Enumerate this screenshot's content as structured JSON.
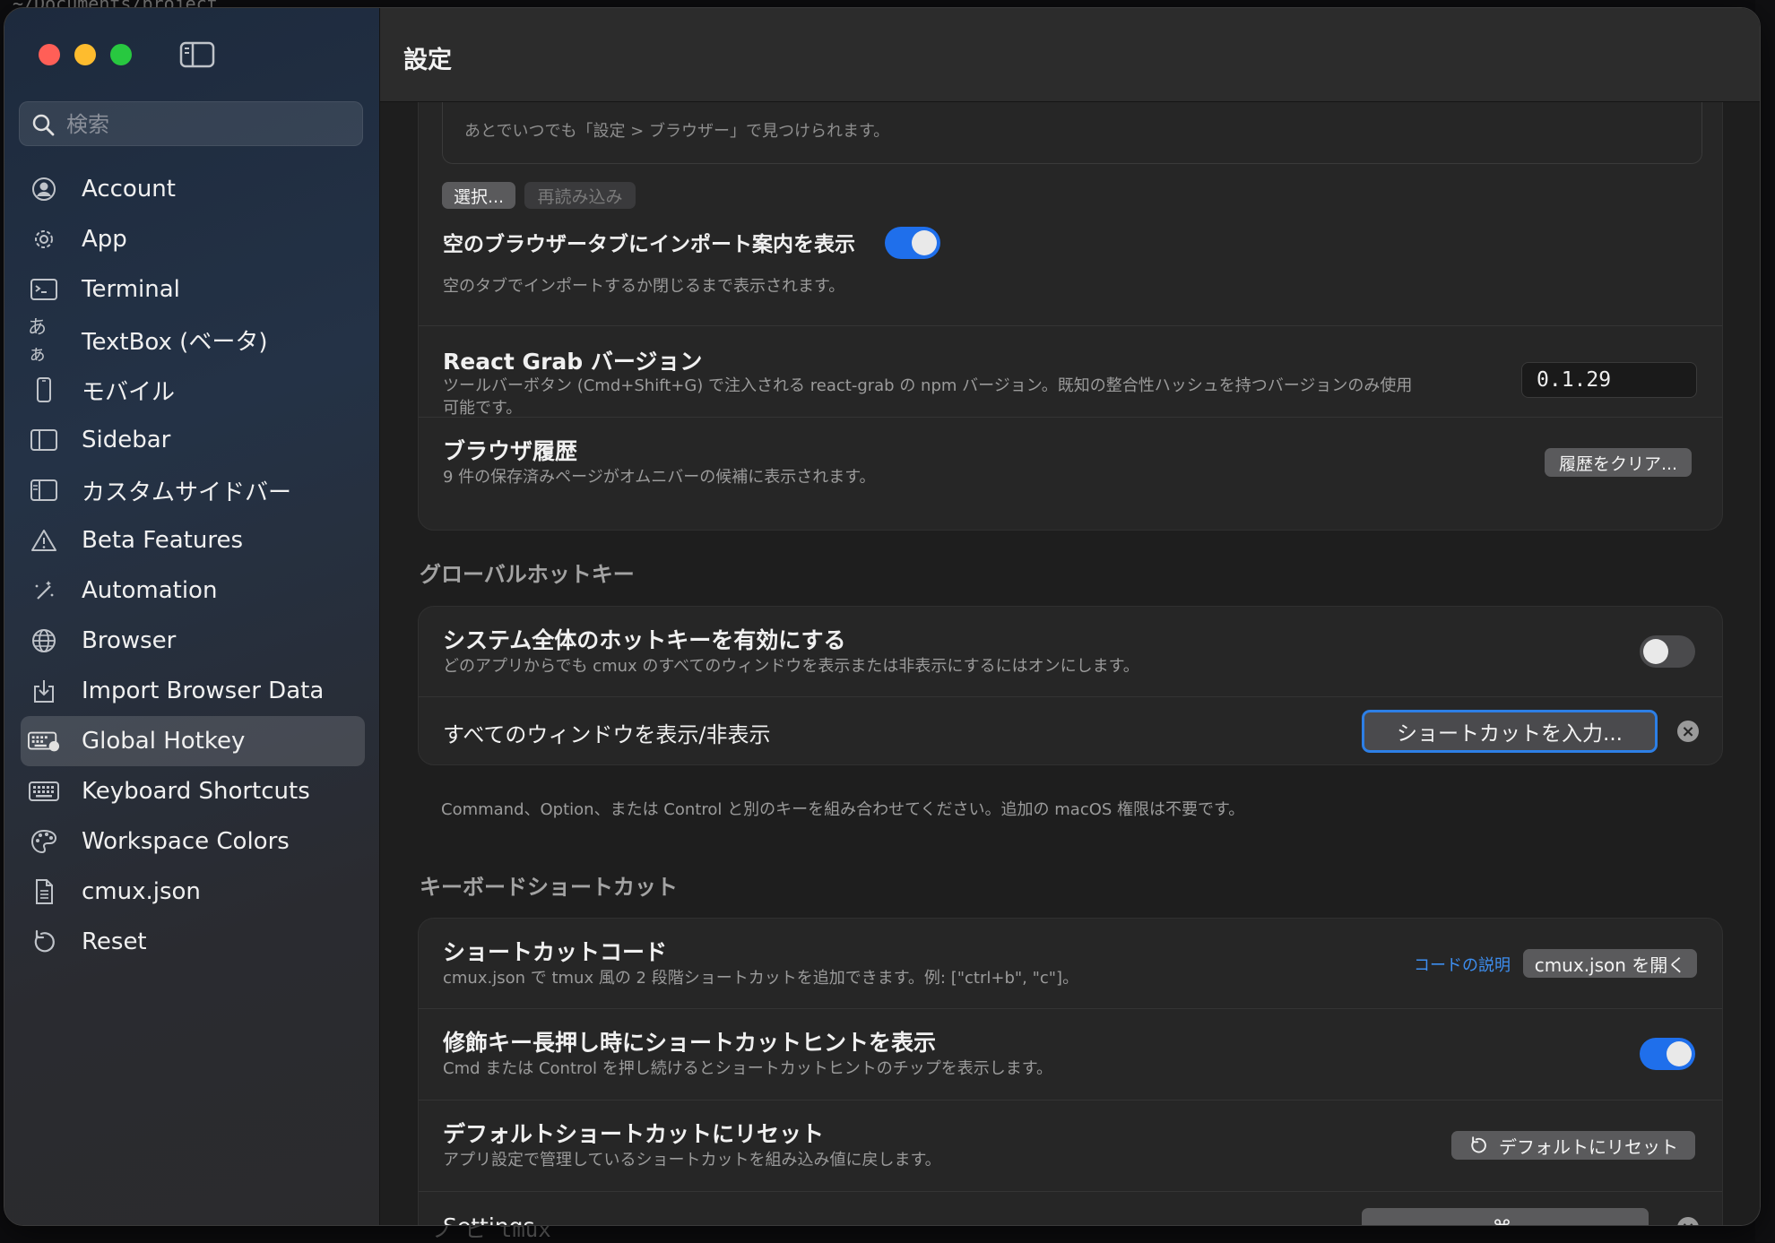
{
  "background": {
    "terminal_path": "~/Documents/project",
    "terminal_bottom": "フ ビ  tmux"
  },
  "window": {
    "title": "設定"
  },
  "sidebar": {
    "search_placeholder": "検索",
    "items": [
      {
        "label": "Account",
        "icon": "person-circle-icon"
      },
      {
        "label": "App",
        "icon": "gear-icon"
      },
      {
        "label": "Terminal",
        "icon": "terminal-icon"
      },
      {
        "label": "TextBox (ベータ)",
        "icon": "textbox-icon",
        "glyph": "あぁ"
      },
      {
        "label": "モバイル",
        "icon": "phone-icon"
      },
      {
        "label": "Sidebar",
        "icon": "sidebar-icon"
      },
      {
        "label": "カスタムサイドバー",
        "icon": "custom-sidebar-icon"
      },
      {
        "label": "Beta Features",
        "icon": "warning-triangle-icon"
      },
      {
        "label": "Automation",
        "icon": "magic-wand-icon"
      },
      {
        "label": "Browser",
        "icon": "globe-icon"
      },
      {
        "label": "Import Browser Data",
        "icon": "import-icon"
      },
      {
        "label": "Global Hotkey",
        "icon": "keyboard-badge-icon",
        "selected": true
      },
      {
        "label": "Keyboard Shortcuts",
        "icon": "keyboard-icon"
      },
      {
        "label": "Workspace Colors",
        "icon": "palette-icon"
      },
      {
        "label": "cmux.json",
        "icon": "document-icon"
      },
      {
        "label": "Reset",
        "icon": "reset-icon"
      }
    ]
  },
  "browser_card": {
    "hint": "あとでいつでも「設定 > ブラウザー」で見つけられます。",
    "select_button": "選択...",
    "reload_button": "再読み込み",
    "import_hint_title": "空のブラウザータブにインポート案内を表示",
    "import_hint_toggle": true,
    "import_hint_sub": "空のタブでインポートするか閉じるまで表示されます。",
    "react_grab_title": "React Grab バージョン",
    "react_grab_sub_1": "ツールバーボタン (Cmd+Shift+G) で注入される react-grab の npm バージョン。既知の整合性ハッシュを持つバージョンのみ使用",
    "react_grab_sub_2": "可能です。",
    "react_grab_version": "0.1.29",
    "history_title": "ブラウザ履歴",
    "history_sub": "9 件の保存済みページがオムニバーの候補に表示されます。",
    "history_button": "履歴をクリア..."
  },
  "global_hotkey": {
    "section": "グローバルホットキー",
    "enable_title": "システム全体のホットキーを有効にする",
    "enable_sub": "どのアプリからでも cmux のすべてのウィンドウを表示または非表示にするにはオンにします。",
    "enable_toggle": false,
    "show_all_title": "すべてのウィンドウを表示/非表示",
    "shortcut_button": "ショートカットを入力...",
    "footnote": "Command、Option、または Control と別のキーを組み合わせてください。追加の macOS 権限は不要です。"
  },
  "keyboard_shortcuts": {
    "section": "キーボードショートカット",
    "code_title": "ショートカットコード",
    "code_sub": "cmux.json で tmux 風の 2 段階ショートカットを追加できます。例: [\"ctrl+b\", \"c\"]。",
    "code_link": "コードの説明",
    "code_button": "cmux.json を開く",
    "hint_title": "修飾キー長押し時にショートカットヒントを表示",
    "hint_sub": "Cmd または Control を押し続けるとショートカットヒントのチップを表示します。",
    "hint_toggle": true,
    "reset_title": "デフォルトショートカットにリセット",
    "reset_sub": "アプリ設定で管理しているショートカットを組み込み値に戻します。",
    "reset_button": "デフォルトにリセット",
    "settings_title": "Settings",
    "settings_shortcut": "⌘,"
  },
  "colors": {
    "accent": "#1f6feb",
    "focus_ring": "#2d7fe6",
    "link": "#3d8ef0"
  }
}
